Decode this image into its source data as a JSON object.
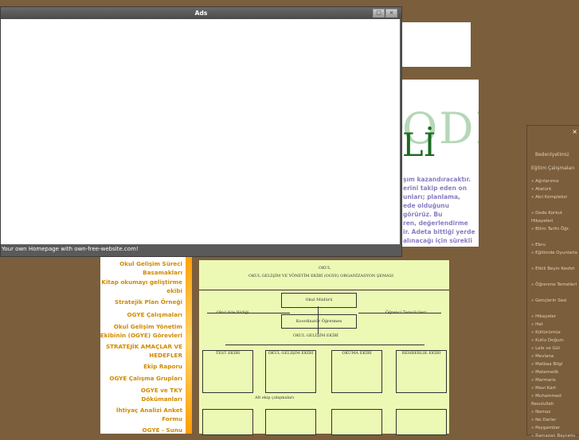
{
  "ads": {
    "title": "Ads",
    "footer": "Your own Homepage with own-free-website.com!"
  },
  "content": {
    "logo_faded": "ODELİ",
    "logo_strong": "Lİ",
    "paragraph_lines": [
      "şım kazandıracaktır.",
      "erini takip eden on",
      "unları; planlama,",
      "ede olduğunu görürüz. Bu",
      "ren, değerlendirme",
      "ir. Adeta bittiği yerde",
      "alınacağı için sürekli"
    ]
  },
  "menu": {
    "items": [
      "Okul Gelişim Süreci Basamakları",
      "Kitap okumayı geliştirme ekibi",
      "Stratejik Plan Örneği",
      "OGYE Çalışmaları",
      "Okul Gelişim Yönetim Ekibinin (OGYE) Görevleri",
      "STRATEJİK AMAÇLAR VE HEDEFLER",
      "Ekip Raporu",
      "OGYE Çalışma Grupları",
      "OGYE ve TKY Dökümanları",
      "İhtiyaç Analizi Anket Formu",
      "OGYE - Sunu"
    ]
  },
  "diagram": {
    "title": "OKUL",
    "subtitle": "OKUL GELİŞİM VE YÖNETİM EKİBİ (OGYE) ORGANİZASYON ŞEMASI",
    "top_box": "Okul Müdürü",
    "left_top": "Okul Aile Birliği",
    "right_top": "Öğrenci Temsilcileri",
    "middle": "Koordinatör Öğretmen",
    "middle2": "OKUL GELİŞİM EKİBİ",
    "team1": "TEST EKİBİ",
    "team2": "OKUL GELİŞİM EKİBİ",
    "team3": "OKUMA EKİBİ",
    "team4": "REHBERLİK EKİBİ",
    "bottom_note": "Alt ekip çalışmaları"
  },
  "sidebar": {
    "close": "×",
    "title": "Bedenlyetimiz",
    "subtitle": "Eğitim Çalışmaları",
    "items": [
      "» Ağrılarımız",
      "» Atatürk",
      "» Akıl Kompleksi",
      "» Dede Korkut Hikayeleri",
      "» Bilim Tarihi Öğr.",
      "» Ebru",
      "» Eğitimde Oyunlarla",
      "» Etkili Beyin Kesfet",
      "» Öğrenme Temelleri",
      "» Gençlerin Sesi",
      "» Hikayeler",
      "» Hat",
      "» Kültürümüz",
      "» Kutlu Doğum",
      "» Lale ve Gül",
      "» Mevlana",
      "» Matbaa Bilgi",
      "» Matematik",
      "» Marmaris",
      "» Mavi Kart",
      "» Muhammed Resulullah",
      "» Namaz",
      "» Ne Derler",
      "» Peygamber",
      "» Ramazan Bayramı"
    ]
  }
}
